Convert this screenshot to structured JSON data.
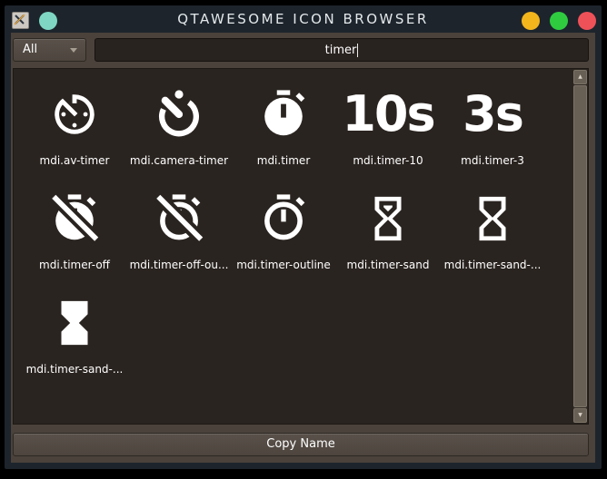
{
  "window": {
    "title": "QTAWESOME ICON BROWSER"
  },
  "toolbar": {
    "filter_selected": "All",
    "search_value": "timer"
  },
  "grid": {
    "items": [
      {
        "label": "mdi.av-timer",
        "icon": "av-timer"
      },
      {
        "label": "mdi.camera-timer",
        "icon": "camera-timer"
      },
      {
        "label": "mdi.timer",
        "icon": "timer"
      },
      {
        "label": "mdi.timer-10",
        "icon": "timer-10",
        "glyph_text": "10s"
      },
      {
        "label": "mdi.timer-3",
        "icon": "timer-3",
        "glyph_text": "3s"
      },
      {
        "label": "mdi.timer-off",
        "icon": "timer-off"
      },
      {
        "label": "mdi.timer-off-ou...",
        "icon": "timer-off-outline"
      },
      {
        "label": "mdi.timer-outline",
        "icon": "timer-outline"
      },
      {
        "label": "mdi.timer-sand",
        "icon": "timer-sand"
      },
      {
        "label": "mdi.timer-sand-...",
        "icon": "timer-sand-empty"
      },
      {
        "label": "mdi.timer-sand-...",
        "icon": "timer-sand-full"
      }
    ]
  },
  "footer": {
    "copy_button": "Copy Name"
  },
  "colors": {
    "accent_teal": "#7fd7c3",
    "control_yellow": "#f2b51c",
    "control_green": "#2fcc40",
    "control_red": "#ef5159",
    "icon_color": "#ffffff",
    "list_background": "#2a2420",
    "window_background": "#4a423b",
    "frame_background": "#1d242c"
  }
}
